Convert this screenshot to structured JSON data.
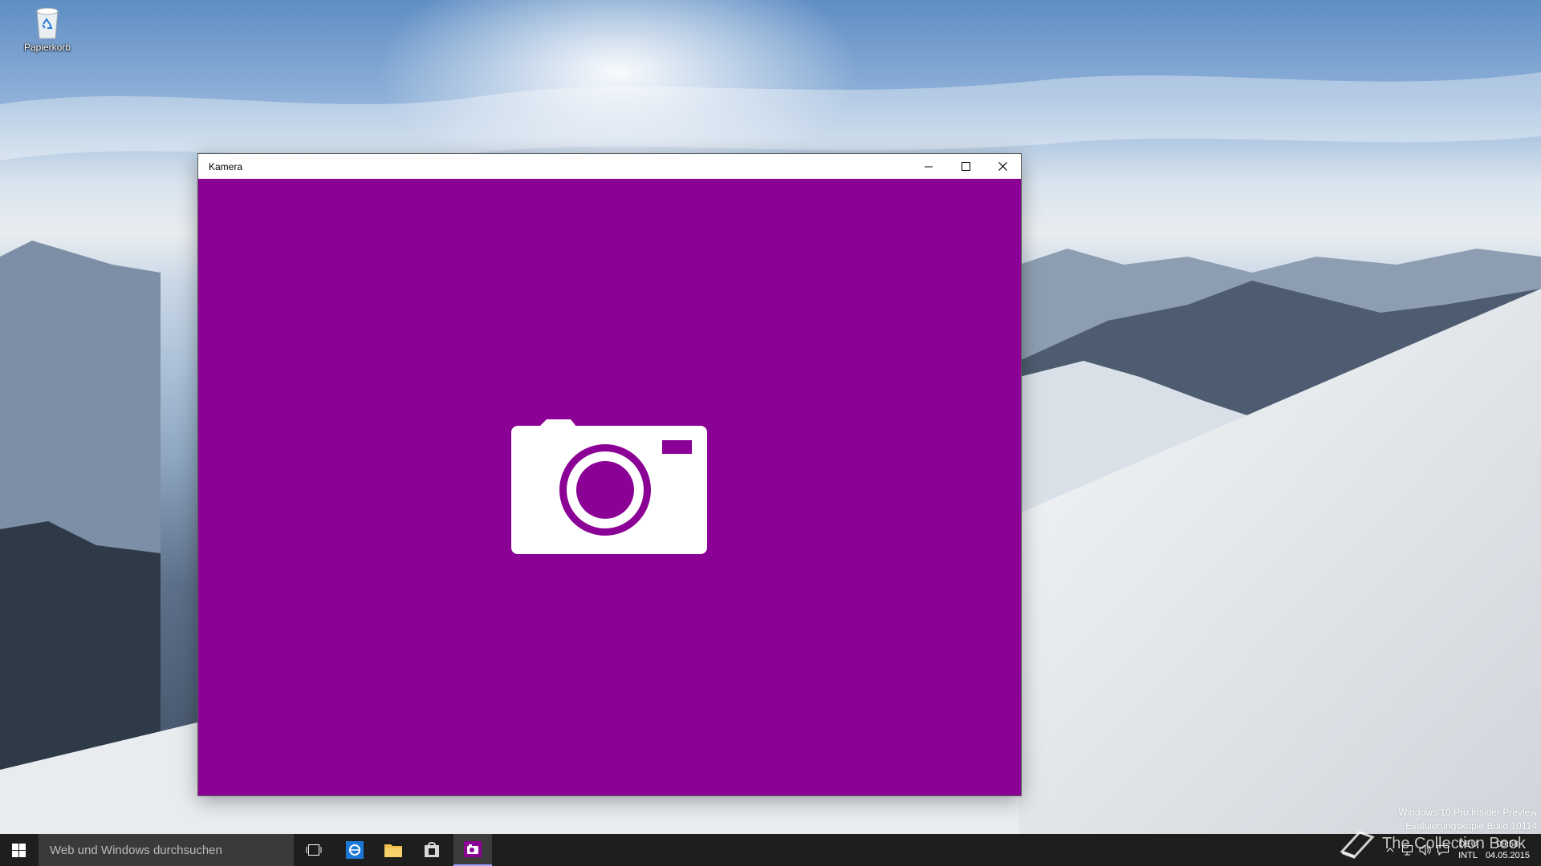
{
  "desktop": {
    "icons": [
      {
        "label": "Papierkorb",
        "icon": "recycle-bin-icon"
      }
    ]
  },
  "window": {
    "title": "Kamera",
    "controls": {
      "minimize": "minimize-icon",
      "maximize": "maximize-icon",
      "close": "close-icon"
    },
    "background_color": "#8b0095",
    "splash_icon": "camera-icon"
  },
  "taskbar": {
    "start_icon": "windows-logo-icon",
    "search": {
      "placeholder": "Web und Windows durchsuchen"
    },
    "apps": [
      {
        "icon": "task-view-icon",
        "active": false
      },
      {
        "icon": "internet-explorer-icon",
        "active": false
      },
      {
        "icon": "file-explorer-icon",
        "active": false
      },
      {
        "icon": "store-icon",
        "active": false
      },
      {
        "icon": "camera-app-icon",
        "active": true
      }
    ],
    "tray": {
      "icons": [
        "chevron-up-icon",
        "network-icon",
        "volume-icon",
        "action-center-icon"
      ],
      "language": {
        "line1": "DEU",
        "line2": "INTL"
      },
      "time": "09:58",
      "date": "04.05.2015"
    }
  },
  "watermark": {
    "line1": "Windows 10 Pro Insider Preview",
    "line2": "Evaluierungskopie Build 10114"
  },
  "overlay_logo": {
    "text": "The Collection Book"
  }
}
